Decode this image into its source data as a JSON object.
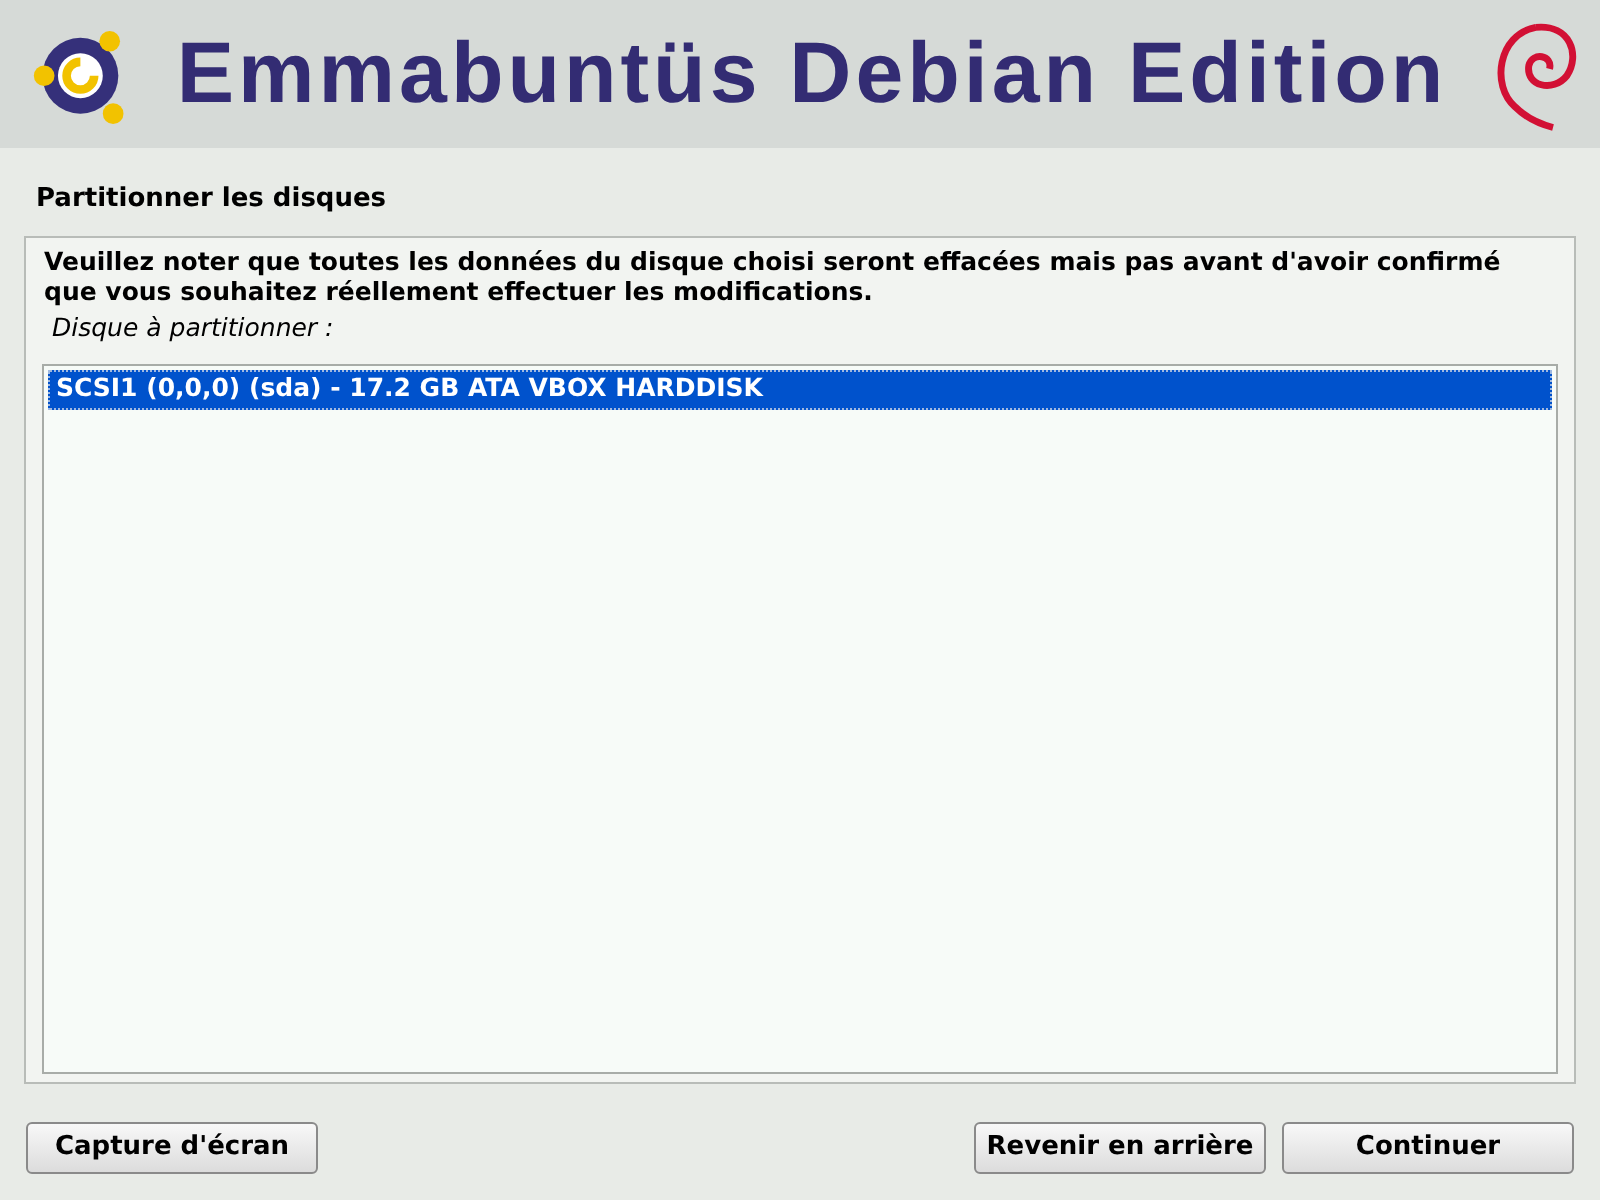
{
  "banner": {
    "title": "Emmabuntüs Debian Edition"
  },
  "page_title": "Partitionner les disques",
  "message": "Veuillez noter que toutes les données du disque choisi seront effacées mais pas avant d'avoir confirmé que vous souhaitez réellement effectuer les modifications.",
  "list_label": "Disque à partitionner :",
  "disks": [
    {
      "label": "SCSI1 (0,0,0) (sda) - 17.2 GB ATA VBOX HARDDISK",
      "selected": true
    }
  ],
  "buttons": {
    "left": [
      "Capture d'écran"
    ],
    "right": [
      "Revenir en arrière",
      "Continuer"
    ]
  }
}
